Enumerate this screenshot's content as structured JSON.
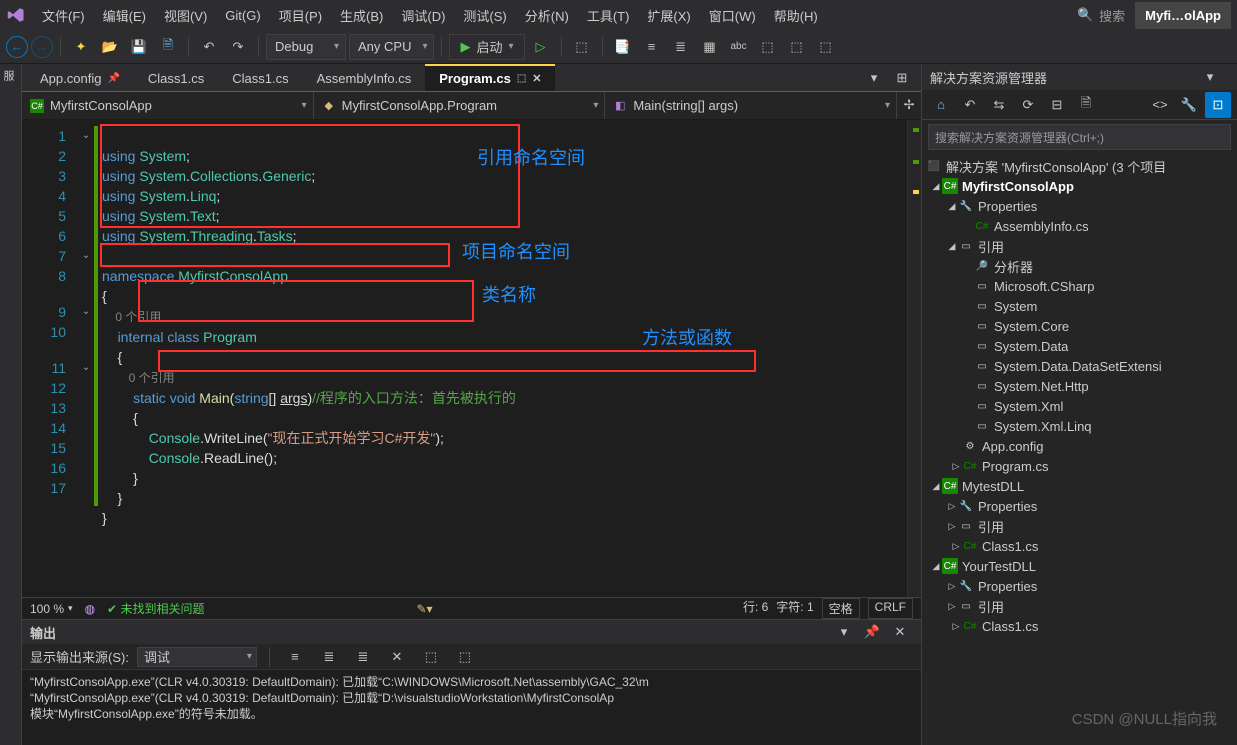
{
  "app_badge": "Myfi…olApp",
  "menu": {
    "file": "文件(F)",
    "edit": "编辑(E)",
    "view": "视图(V)",
    "git": "Git(G)",
    "project": "项目(P)",
    "build": "生成(B)",
    "debug": "调试(D)",
    "test": "测试(S)",
    "analyze": "分析(N)",
    "tools": "工具(T)",
    "extensions": "扩展(X)",
    "window": "窗口(W)",
    "help": "帮助(H)"
  },
  "search_placeholder": "搜索",
  "toolbar": {
    "config": "Debug",
    "platform": "Any CPU",
    "start": "启动"
  },
  "tabs": [
    "App.config",
    "Class1.cs",
    "Class1.cs",
    "AssemblyInfo.cs",
    "Program.cs"
  ],
  "active_tab": "Program.cs",
  "nav": {
    "scope": "MyfirstConsolApp",
    "type": "MyfirstConsolApp.Program",
    "member": "Main(string[] args)"
  },
  "code": {
    "line_count": 17,
    "lines": [
      "using System;",
      "using System.Collections.Generic;",
      "using System.Linq;",
      "using System.Text;",
      "using System.Threading.Tasks;",
      "",
      "namespace MyfirstConsolApp",
      "{",
      "",
      "    internal class Program",
      "    {",
      "",
      "        static void Main(string[] args)//程序的入口方法：首先被执行的",
      "        {",
      "            Console.WriteLine(\"现在正式开始学习C#开发\");",
      "            Console.ReadLine();",
      "        }",
      "    }",
      "}"
    ],
    "codelens1": "0 个引用",
    "codelens2": "0 个引用",
    "console_text": "现在正式开始学习C#开发"
  },
  "annotations": {
    "a1": "引用命名空间",
    "a2": "项目命名空间",
    "a3": "类名称",
    "a4": "方法或函数"
  },
  "status": {
    "zoom": "100 %",
    "issues": "未找到相关问题",
    "line": "行: 6",
    "col": "字符: 1",
    "space": "空格",
    "enc": "CRLF"
  },
  "output": {
    "title": "输出",
    "src_label": "显示输出来源(S):",
    "src": "调试",
    "line1": "“MyfirstConsolApp.exe”(CLR v4.0.30319: DefaultDomain): 已加载“C:\\WINDOWS\\Microsoft.Net\\assembly\\GAC_32\\m",
    "line2": "“MyfirstConsolApp.exe”(CLR v4.0.30319: DefaultDomain): 已加载“D:\\visualstudioWorkstation\\MyfirstConsolAp",
    "line3": "模块“MyfirstConsolApp.exe”的符号未加载。"
  },
  "sln": {
    "title": "解决方案资源管理器",
    "search": "搜索解决方案资源管理器(Ctrl+;)",
    "root": "解决方案 'MyfirstConsolApp' (3 个项目",
    "p1": "MyfirstConsolApp",
    "properties": "Properties",
    "asm": "AssemblyInfo.cs",
    "refs": "引用",
    "r_ana": "分析器",
    "r1": "Microsoft.CSharp",
    "r2": "System",
    "r3": "System.Core",
    "r4": "System.Data",
    "r5": "System.Data.DataSetExtensi",
    "r6": "System.Net.Http",
    "r7": "System.Xml",
    "r8": "System.Xml.Linq",
    "appcfg": "App.config",
    "prog": "Program.cs",
    "p2": "MytestDLL",
    "p2_cls": "Class1.cs",
    "p3": "YourTestDLL",
    "p3_cls": "Class1.cs"
  },
  "watermark": "CSDN @NULL指向我"
}
